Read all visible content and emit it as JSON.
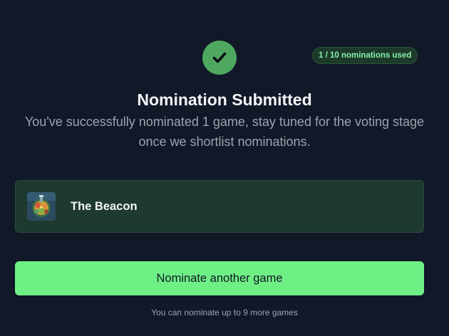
{
  "header": {
    "status_icon": "check-icon",
    "usage_badge": "1 / 10 nominations used"
  },
  "confirmation": {
    "title": "Nomination Submitted",
    "message": "You've successfully nominated 1 game, stay tuned for the voting stage once we shortlist nominations."
  },
  "nominated_game": {
    "name": "The Beacon",
    "thumbnail_icon": "game-cover-art"
  },
  "actions": {
    "nominate_another_label": "Nominate another game",
    "remaining_note": "You can nominate up to 9 more games"
  },
  "colors": {
    "background": "#111827",
    "accent_green": "#6ef085",
    "check_circle": "#4ea85f",
    "card_background": "#1e3a30",
    "badge_text": "#86efac"
  }
}
